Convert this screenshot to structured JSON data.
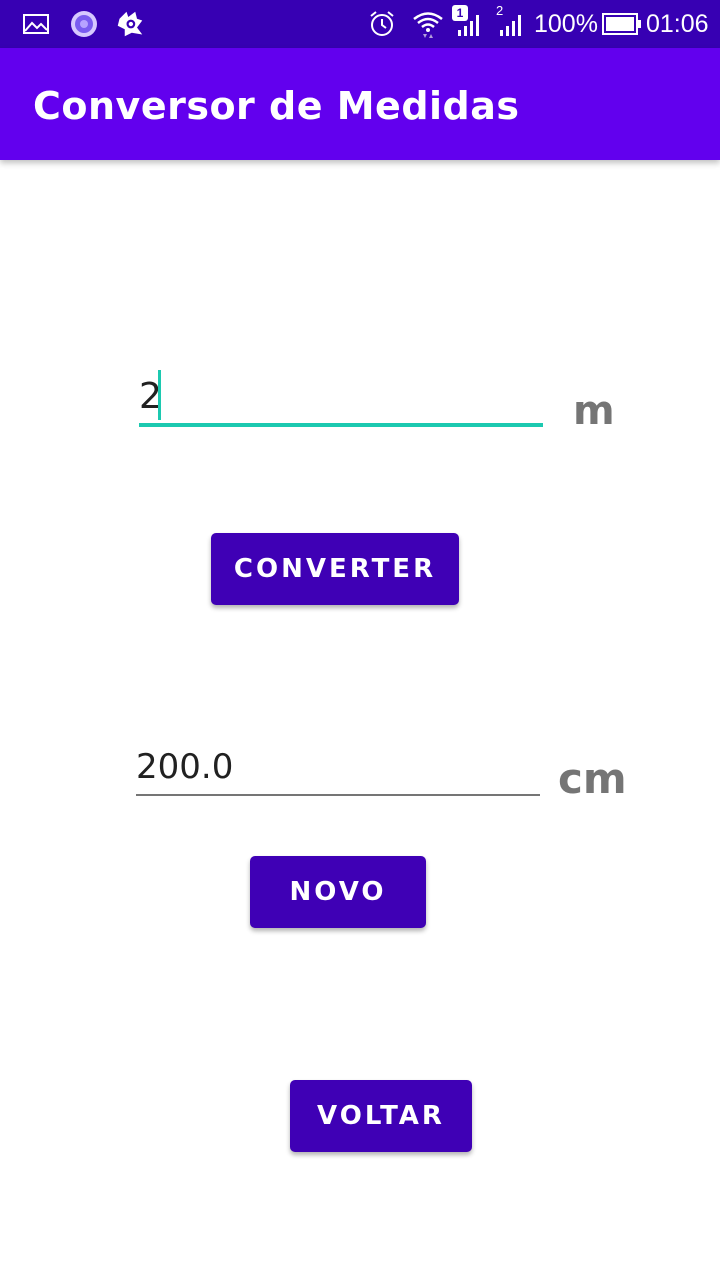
{
  "status_bar": {
    "battery_percent": "100%",
    "time": "01:06",
    "sim1_badge": "1",
    "sim2_badge": "2",
    "icons": [
      "gallery-icon",
      "sync-circle-icon",
      "avast-icon",
      "alarm-icon",
      "wifi-icon",
      "signal-sim1-icon",
      "signal-sim2-icon",
      "battery-icon"
    ],
    "bg_color": "#3700b3"
  },
  "app_bar": {
    "title": "Conversor de Medidas",
    "bg_color": "#6200ee"
  },
  "input": {
    "value": "2",
    "unit": "m",
    "accent_color": "#1cc9b0"
  },
  "result": {
    "value": "200.0",
    "unit": "cm"
  },
  "buttons": {
    "convert_label": "CONVERTER",
    "new_label": "NOVO",
    "back_label": "VOLTAR",
    "color": "#3f00b5"
  }
}
